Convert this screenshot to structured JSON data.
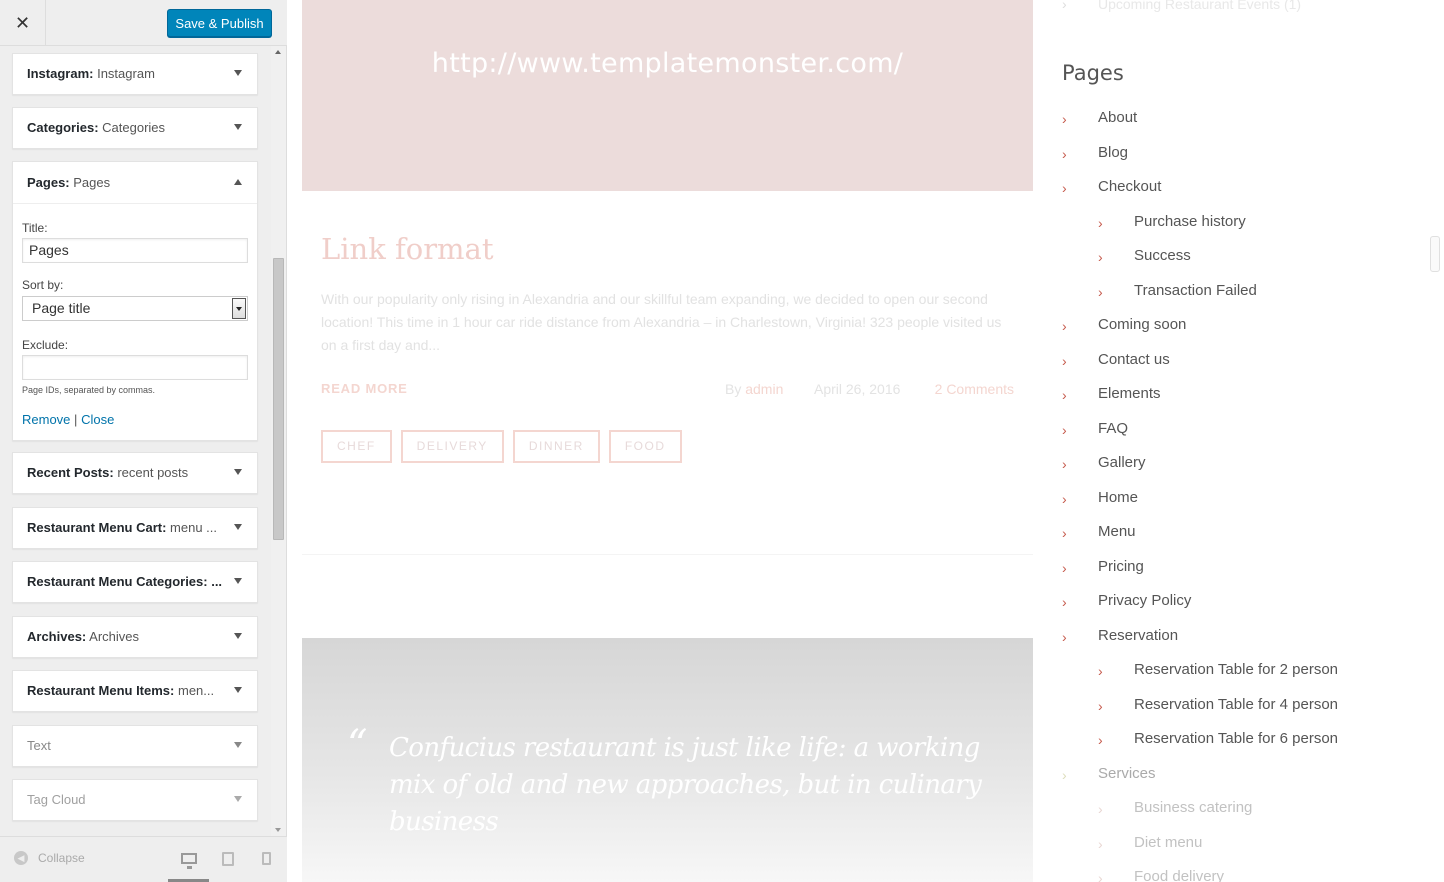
{
  "header": {
    "close_icon": "✕",
    "publish_label": "Save & Publish"
  },
  "widgets": [
    {
      "name": "Instagram:",
      "value": "Instagram"
    },
    {
      "name": "Categories:",
      "value": "Categories"
    }
  ],
  "pages_widget": {
    "name": "Pages:",
    "value": "Pages",
    "title_label": "Title:",
    "title_value": "Pages",
    "sort_label": "Sort by:",
    "sort_value": "Page title",
    "exclude_label": "Exclude:",
    "exclude_value": "",
    "hint": "Page IDs, separated by commas.",
    "remove_label": "Remove",
    "separator": "|",
    "close_label": "Close"
  },
  "widgets_after": [
    {
      "name": "Recent Posts:",
      "value": "recent posts"
    },
    {
      "name": "Restaurant Menu Cart:",
      "value": "menu ..."
    },
    {
      "name": "Restaurant Menu Categories: ...",
      "value": ""
    },
    {
      "name": "Archives:",
      "value": "Archives"
    },
    {
      "name": "Restaurant Menu Items:",
      "value": "men..."
    },
    {
      "name": "Text",
      "value": ""
    },
    {
      "name": "Tag Cloud",
      "value": ""
    }
  ],
  "footer": {
    "collapse_label": "Collapse",
    "devices": [
      "desktop-icon",
      "tablet-icon",
      "mobile-icon"
    ]
  },
  "preview": {
    "link_url": "http://www.templatemonster.com/",
    "post_title": "Link format",
    "post_excerpt": "With our popularity only rising in Alexandria and our skillful team expanding, we decided to open our second location! This time in 1 hour car ride distance from Alexandria – in Charlestown, Virginia! 323 people visited us on a first day and...",
    "read_more": "READ MORE",
    "meta_by": "By",
    "meta_author": "admin",
    "meta_date": "April 26, 2016",
    "meta_comments": "2 Comments",
    "tags": [
      "CHEF",
      "DELIVERY",
      "DINNER",
      "FOOD"
    ],
    "quote_mark": "“",
    "quote_text": "Confucius restaurant is just like life: a working mix of old and new approaches, but in culinary business",
    "prev_event": "Upcoming Restaurant Events (1)",
    "pages_title": "Pages",
    "pages": [
      {
        "label": "About",
        "level": 0
      },
      {
        "label": "Blog",
        "level": 0
      },
      {
        "label": "Checkout",
        "level": 0
      },
      {
        "label": "Purchase history",
        "level": 1
      },
      {
        "label": "Success",
        "level": 1
      },
      {
        "label": "Transaction Failed",
        "level": 1
      },
      {
        "label": "Coming soon",
        "level": 0
      },
      {
        "label": "Contact us",
        "level": 0
      },
      {
        "label": "Elements",
        "level": 0
      },
      {
        "label": "FAQ",
        "level": 0
      },
      {
        "label": "Gallery",
        "level": 0
      },
      {
        "label": "Home",
        "level": 0
      },
      {
        "label": "Menu",
        "level": 0
      },
      {
        "label": "Pricing",
        "level": 0
      },
      {
        "label": "Privacy Policy",
        "level": 0
      },
      {
        "label": "Reservation",
        "level": 0
      },
      {
        "label": "Reservation Table for 2 person",
        "level": 1
      },
      {
        "label": "Reservation Table for 4 person",
        "level": 1
      },
      {
        "label": "Reservation Table for 6 person",
        "level": 1
      },
      {
        "label": "Services",
        "level": 0
      },
      {
        "label": "Business catering",
        "level": 1
      },
      {
        "label": "Diet menu",
        "level": 1
      },
      {
        "label": "Food delivery",
        "level": 1
      }
    ],
    "chevron": "›"
  }
}
